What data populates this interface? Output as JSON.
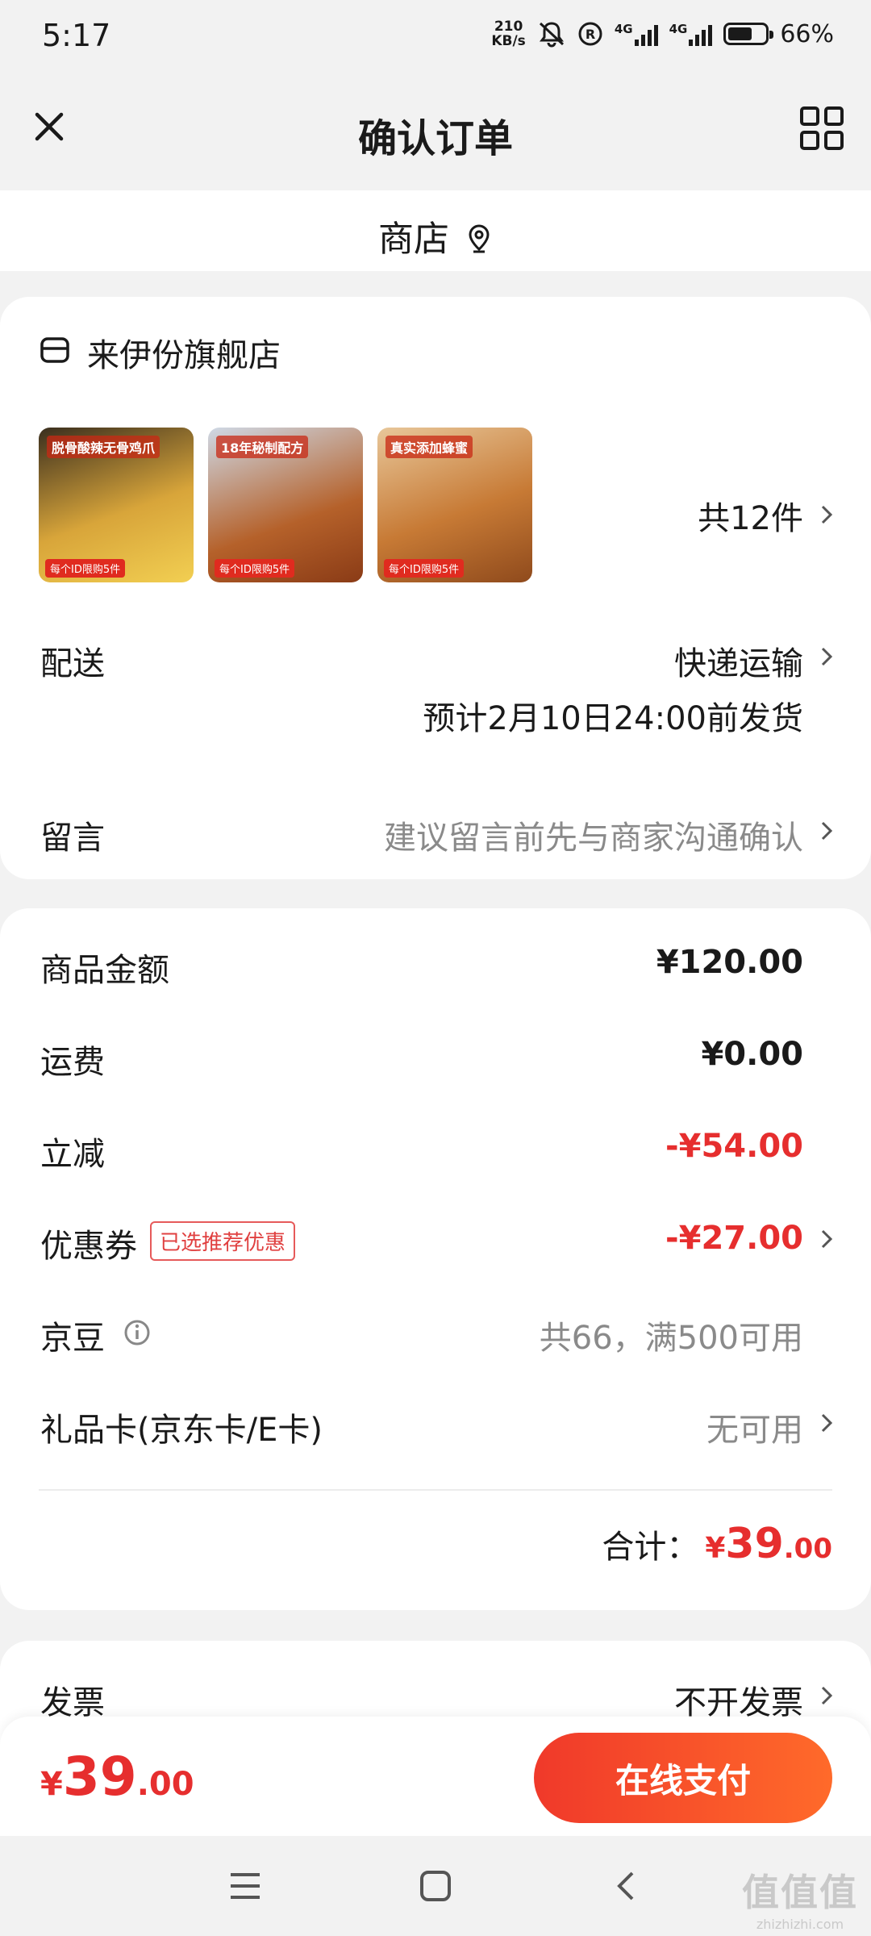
{
  "status_bar": {
    "time": "5:17",
    "net_speed_value": "210",
    "net_speed_unit": "KB/s",
    "network_1": "4G",
    "network_2": "4G",
    "battery_percent": "66%",
    "battery_level": 0.66
  },
  "header": {
    "title": "确认订单",
    "close_icon": "close-icon",
    "menu_icon": "grid-icon"
  },
  "store_bar": {
    "label": "商店",
    "icon": "location-pin-icon"
  },
  "shop": {
    "name": "来伊份旗舰店",
    "icon": "store-icon",
    "items": [
      {
        "caption": "脱骨酸辣无骨鸡爪",
        "tag": "每个ID限购5件",
        "palette": "#d8a53a"
      },
      {
        "caption": "18年秘制配方",
        "tag": "每个ID限购5件",
        "palette": "#b5612a"
      },
      {
        "caption": "真实添加蜂蜜",
        "tag": "每个ID限购5件",
        "palette": "#c77a35"
      }
    ],
    "item_count": "共12件"
  },
  "delivery": {
    "label": "配送",
    "method": "快递运输",
    "estimate": "预计2月10日24:00前发货"
  },
  "message": {
    "label": "留言",
    "placeholder": "建议留言前先与商家沟通确认"
  },
  "price": {
    "goods_label": "商品金额",
    "goods_value": "¥120.00",
    "shipping_label": "运费",
    "shipping_value": "¥0.00",
    "discount_label": "立减",
    "discount_value": "-¥54.00",
    "coupon_label": "优惠券",
    "coupon_badge": "已选推荐优惠",
    "coupon_value": "-¥27.00",
    "jingdou_label": "京豆",
    "jingdou_value": "共66，满500可用",
    "giftcard_label": "礼品卡(京东卡/E卡)",
    "giftcard_value": "无可用",
    "total_label": "合计：",
    "total_currency": "¥",
    "total_int": "39",
    "total_dec": ".00"
  },
  "invoice": {
    "label": "发票",
    "value": "不开发票"
  },
  "paybar": {
    "currency": "¥",
    "amount_int": "39",
    "amount_dec": ".00",
    "button_label": "在线支付"
  },
  "watermark": {
    "glyphs": "值值值",
    "site": "zhizhizhi.com"
  },
  "colors": {
    "accent_red": "#e62e2e",
    "button_gradient_start": "#f0392a",
    "button_gradient_end": "#ff6a2a"
  }
}
